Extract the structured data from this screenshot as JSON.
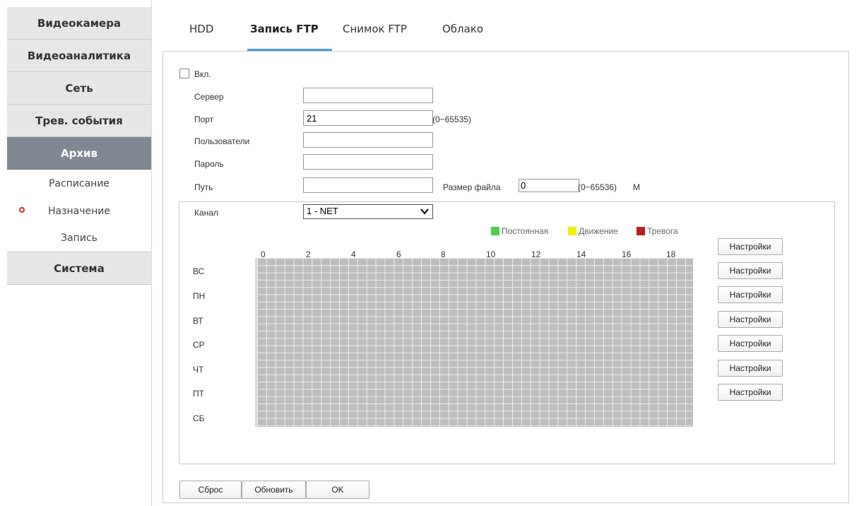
{
  "sidebar": {
    "items": [
      {
        "label": "Видеокамера"
      },
      {
        "label": "Видеоаналитика"
      },
      {
        "label": "Сеть"
      },
      {
        "label": "Трев. события"
      },
      {
        "label": "Архив"
      },
      {
        "label": "Система"
      }
    ],
    "sub_items": [
      {
        "label": "Расписание"
      },
      {
        "label": "Назначение"
      },
      {
        "label": "Запись"
      }
    ]
  },
  "tabs": [
    {
      "label": "HDD"
    },
    {
      "label": "Запись FTP"
    },
    {
      "label": "Снимок FTP"
    },
    {
      "label": "Облако"
    }
  ],
  "form": {
    "enable_label": "Вкл.",
    "server_label": "Сервер",
    "server_value": "",
    "port_label": "Порт",
    "port_value": "21",
    "port_range": "(0~65535)",
    "users_label": "Пользователи",
    "users_value": "",
    "password_label": "Пароль",
    "password_value": "",
    "path_label": "Путь",
    "path_value": "",
    "filesize_label": "Размер файла",
    "filesize_value": "0",
    "filesize_range": "(0~65536)",
    "filesize_unit": "M"
  },
  "schedule": {
    "channel_label": "Канал",
    "channel_value": "1 - NET",
    "legend": [
      {
        "label": "Постоянная",
        "color": "#4cd04c"
      },
      {
        "label": "Движение",
        "color": "#f2f200"
      },
      {
        "label": "Тревога",
        "color": "#b52020"
      }
    ],
    "hours": [
      "0",
      "2",
      "4",
      "6",
      "8",
      "10",
      "12",
      "14",
      "16",
      "18"
    ],
    "days": [
      "ВС",
      "ПН",
      "ВТ",
      "СР",
      "ЧТ",
      "ПТ",
      "СБ"
    ],
    "settings_label": "Настройки"
  },
  "footer": {
    "reset_label": "Сброс",
    "refresh_label": "Обновить",
    "ok_label": "OK"
  },
  "colors": {
    "active_nav": "#7f8893",
    "tab_underline": "#4b9bd8",
    "grid_fill": "#bdbdbd"
  }
}
